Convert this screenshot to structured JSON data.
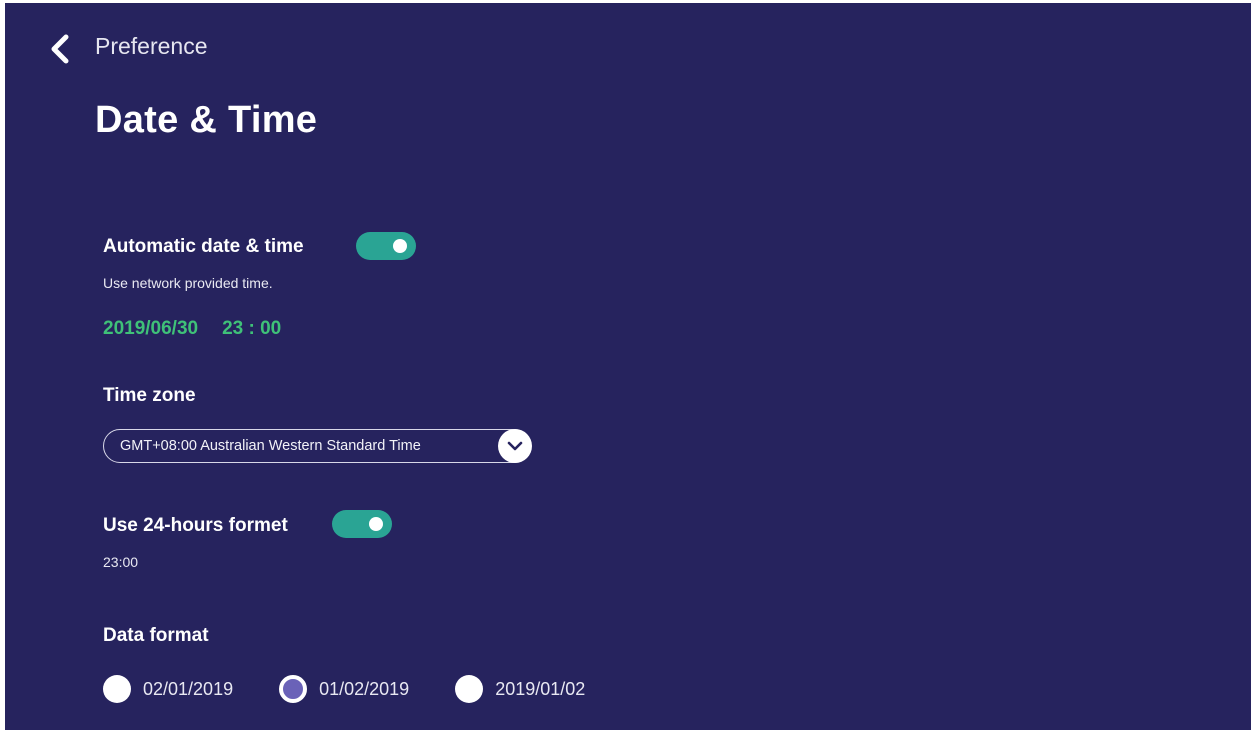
{
  "header": {
    "breadcrumb": "Preference",
    "title": "Date & Time",
    "back_icon": "chevron-left-icon"
  },
  "automatic": {
    "label": "Automatic date & time",
    "description": "Use network provided time.",
    "enabled": true,
    "date": "2019/06/30",
    "time": "23 : 00"
  },
  "timezone": {
    "label": "Time zone",
    "selected": "GMT+08:00 Australian Western Standard Time",
    "dropdown_icon": "chevron-down-icon"
  },
  "hour24": {
    "label": "Use 24-hours formet",
    "enabled": true,
    "example": "23:00"
  },
  "date_format": {
    "label": "Data format",
    "options": [
      {
        "label": "02/01/2019",
        "selected": false
      },
      {
        "label": "01/02/2019",
        "selected": true
      },
      {
        "label": "2019/01/02",
        "selected": false
      }
    ]
  },
  "colors": {
    "background": "#26235e",
    "accent_green": "#3fc178",
    "toggle_on": "#2aa494",
    "radio_selected": "#6a62b8"
  }
}
